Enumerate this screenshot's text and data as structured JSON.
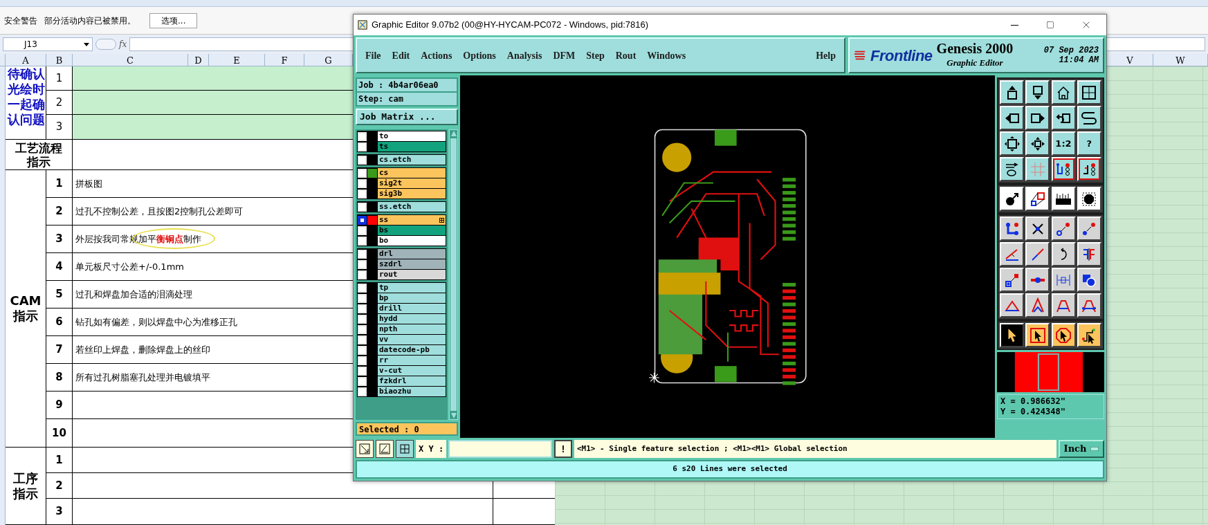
{
  "excel": {
    "security_bar": {
      "title": "安全警告",
      "message": "部分活动内容已被禁用。",
      "button": "选项..."
    },
    "formula_bar": {
      "name_box": "J13",
      "fx": "fx"
    },
    "columns_left": [
      "A",
      "B",
      "C",
      "D",
      "E",
      "F",
      "G"
    ],
    "columns_right": [
      "V",
      "W"
    ],
    "sections": [
      {
        "kind": "pending",
        "label": "待确认光绘时一起确认问题",
        "rows": [
          {
            "number": "1"
          },
          {
            "number": "2"
          },
          {
            "number": "3"
          }
        ]
      },
      {
        "kind": "header",
        "label": "工艺流程指示"
      },
      {
        "kind": "steps",
        "label": "CAM指示",
        "rows": [
          {
            "number": "1",
            "parts": [
              {
                "text": "拼板图"
              }
            ],
            "circled": false
          },
          {
            "number": "2",
            "parts": [
              {
                "text": "过孔不控制公差，且按图2控制孔公差即可"
              }
            ],
            "circled": false
          },
          {
            "number": "3",
            "parts": [
              {
                "text": "外层按我司常规加平"
              },
              {
                "text": "衡铜点",
                "color": "#e01010"
              },
              {
                "text": "制作"
              }
            ],
            "circled": true
          },
          {
            "number": "4",
            "parts": [
              {
                "text": "单元板尺寸公差+/-0.1mm"
              }
            ],
            "circled": false
          },
          {
            "number": "5",
            "parts": [
              {
                "text": "过孔和焊盘加合适的泪滴处理"
              }
            ],
            "circled": false
          },
          {
            "number": "6",
            "parts": [
              {
                "text": "钻孔如有偏差，则以焊盘中心为准移正孔"
              }
            ],
            "circled": false
          },
          {
            "number": "7",
            "parts": [
              {
                "text": "若丝印上焊盘，删除焊盘上的丝印"
              }
            ],
            "circled": false
          },
          {
            "number": "8",
            "parts": [
              {
                "text": "所有过孔树脂塞孔处理并电镀填平"
              }
            ],
            "circled": false
          },
          {
            "number": "9",
            "parts": [],
            "circled": false
          },
          {
            "number": "10",
            "parts": [],
            "circled": false
          }
        ]
      },
      {
        "kind": "steps",
        "label": "工序指示",
        "rows": [
          {
            "number": "1",
            "parts": [],
            "circled": false
          },
          {
            "number": "2",
            "parts": [],
            "circled": false
          },
          {
            "number": "3",
            "parts": [],
            "circled": false
          }
        ]
      }
    ]
  },
  "window": {
    "title": "Graphic Editor 9.07b2 (00@HY-HYCAM-PC072 - Windows, pid:7816)",
    "menu": [
      "File",
      "Edit",
      "Actions",
      "Options",
      "Analysis",
      "DFM",
      "Step",
      "Rout",
      "Windows"
    ],
    "help": "Help",
    "logo": {
      "brand": "Frontline",
      "product": "Genesis 2000",
      "subtitle": "Graphic Editor",
      "date": "07 Sep 2023",
      "time": "11:04 AM"
    },
    "job": "Job : 4b4ar06ea0",
    "step": "Step: cam",
    "job_matrix": "Job Matrix ...",
    "layer_groups": [
      {
        "layers": [
          {
            "name": "to",
            "color": "#ffffff",
            "selected": false,
            "affected": false
          },
          {
            "name": "ts",
            "color": "#12a37e",
            "selected": false,
            "affected": false
          }
        ]
      },
      {
        "layers": [
          {
            "name": "cs.etch",
            "color": "#9fdedc",
            "selected": false,
            "affected": false
          }
        ]
      },
      {
        "layers": [
          {
            "name": "cs",
            "color": "#fcc45c",
            "swatch": {
              "color": "#3a9a1a"
            },
            "selected": false,
            "affected": false
          },
          {
            "name": "sig2t",
            "color": "#fcc45c",
            "selected": false,
            "affected": false
          },
          {
            "name": "sig3b",
            "color": "#fcc45c",
            "selected": false,
            "affected": false
          }
        ]
      },
      {
        "layers": [
          {
            "name": "ss.etch",
            "color": "#9fdedc",
            "selected": false,
            "affected": false
          }
        ]
      },
      {
        "layers": [
          {
            "name": "ss",
            "color": "#fcc45c",
            "swatch": {
              "color": "#ff0000"
            },
            "selected": true,
            "affected": true
          },
          {
            "name": "bs",
            "color": "#12a37e",
            "selected": false,
            "affected": false
          },
          {
            "name": "bo",
            "color": "#ffffff",
            "selected": false,
            "affected": false
          }
        ]
      },
      {
        "layers": [
          {
            "name": "drl",
            "color": "#9fb3b8",
            "selected": false,
            "affected": false
          },
          {
            "name": "szdrl",
            "color": "#9fb3b8",
            "selected": false,
            "affected": false
          },
          {
            "name": "rout",
            "color": "#d8d8d8",
            "selected": false,
            "affected": false
          }
        ]
      },
      {
        "layers": [
          {
            "name": "tp",
            "color": "#9fdedc",
            "selected": false,
            "affected": false
          },
          {
            "name": "bp",
            "color": "#9fdedc",
            "selected": false,
            "affected": false
          },
          {
            "name": "drill",
            "color": "#9fdedc",
            "selected": false,
            "affected": false
          },
          {
            "name": "hydd",
            "color": "#9fdedc",
            "selected": false,
            "affected": false
          },
          {
            "name": "npth",
            "color": "#9fdedc",
            "selected": false,
            "affected": false
          },
          {
            "name": "vv",
            "color": "#9fdedc",
            "selected": false,
            "affected": false
          },
          {
            "name": "datecode-pb",
            "color": "#9fdedc",
            "selected": false,
            "affected": false
          },
          {
            "name": "rr",
            "color": "#9fdedc",
            "selected": false,
            "affected": false
          },
          {
            "name": "v-cut",
            "color": "#9fdedc",
            "selected": false,
            "affected": false
          },
          {
            "name": "fzkdrl",
            "color": "#9fdedc",
            "selected": false,
            "affected": false
          },
          {
            "name": "biaozhu",
            "color": "#9fdedc",
            "selected": false,
            "affected": false
          }
        ]
      }
    ],
    "selected_count": "Selected : 0",
    "tool_groups": [
      {
        "kind": "teal",
        "tools": [
          {
            "kind": "box-up",
            "on": false
          },
          {
            "kind": "box-down",
            "on": false
          },
          {
            "kind": "house",
            "on": false
          },
          {
            "kind": "window-grid",
            "on": false
          },
          {
            "kind": "box-left",
            "on": false
          },
          {
            "kind": "box-right",
            "on": false
          },
          {
            "kind": "undo-box",
            "on": false
          },
          {
            "kind": "s-curve",
            "on": false
          },
          {
            "kind": "box-four-arrows",
            "on": false
          },
          {
            "kind": "box-center-arrows",
            "on": false
          },
          {
            "kind": "label",
            "label": "1:2",
            "on": false
          },
          {
            "kind": "label",
            "label": "?",
            "on": false
          },
          {
            "kind": "tools-palette",
            "on": false
          },
          {
            "kind": "grid",
            "on": false
          },
          {
            "kind": "circuit-lights",
            "on": true
          },
          {
            "kind": "circuit-lights-alt",
            "on": true
          }
        ]
      },
      {
        "kind": "white",
        "tools": [
          {
            "kind": "pad-arrow",
            "on": false
          },
          {
            "kind": "linked-squares",
            "on": false
          },
          {
            "kind": "ruler",
            "on": false
          },
          {
            "kind": "octagon-dashed",
            "on": false
          }
        ]
      },
      {
        "kind": "grey",
        "tools": [
          {
            "kind": "connected-dots",
            "on": false
          },
          {
            "kind": "cross-dot",
            "on": false
          },
          {
            "kind": "dot-arrow-hollow",
            "on": false
          },
          {
            "kind": "dot-arrow-solid",
            "on": false
          },
          {
            "kind": "angle-lines",
            "on": false
          },
          {
            "kind": "slanted-line",
            "on": false
          },
          {
            "kind": "rotate-arrow",
            "on": false
          },
          {
            "kind": "mirror-bars",
            "on": false
          },
          {
            "kind": "squares-arrow",
            "on": false
          },
          {
            "kind": "line-dot",
            "on": false
          },
          {
            "kind": "dimension",
            "on": false
          },
          {
            "kind": "overlapping-shapes",
            "on": false
          },
          {
            "kind": "triangle-flat",
            "on": false
          },
          {
            "kind": "triangle-tall",
            "on": false
          },
          {
            "kind": "arch",
            "on": false
          },
          {
            "kind": "arch-cross",
            "on": false
          }
        ]
      },
      {
        "kind": "orange",
        "tools": [
          {
            "kind": "cursor",
            "on": true
          },
          {
            "kind": "cursor-box",
            "on": false
          },
          {
            "kind": "cursor-octagon",
            "on": false
          },
          {
            "kind": "cursor-route",
            "on": false
          }
        ]
      }
    ],
    "coords": {
      "x": "X = 0.986632\"",
      "y": "Y = 0.424348\""
    },
    "xy_label": "X Y :",
    "alert_button": "!",
    "hint": "<M1> - Single feature selection ; <M1><M1> Global selection",
    "units": "Inch",
    "status": "6 s20 Lines were selected"
  }
}
